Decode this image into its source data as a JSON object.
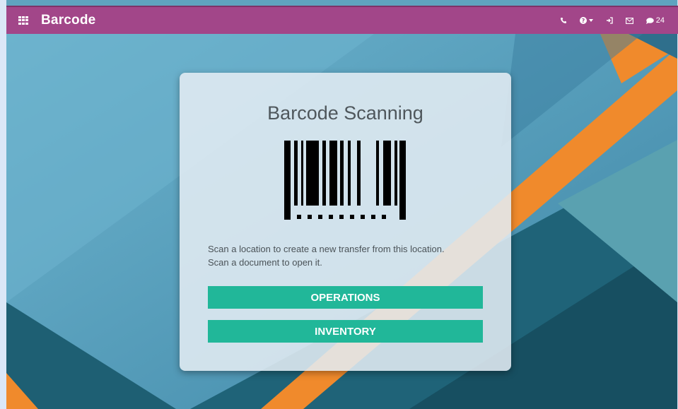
{
  "app": {
    "title": "Barcode"
  },
  "systray": {
    "messages_count": "24"
  },
  "card": {
    "title": "Barcode Scanning",
    "hint_line1": "Scan a location to create a new transfer from this location.",
    "hint_line2": "Scan a document to open it.",
    "operations_label": "OPERATIONS",
    "inventory_label": "INVENTORY"
  },
  "colors": {
    "topbar": "#a24689",
    "button": "#21b799",
    "accent_orange": "#f08a2c",
    "bg_blue": "#5fa3bf"
  },
  "icons": [
    "apps-icon",
    "phone-icon",
    "help-icon",
    "signin-icon",
    "mail-icon",
    "chat-icon"
  ]
}
